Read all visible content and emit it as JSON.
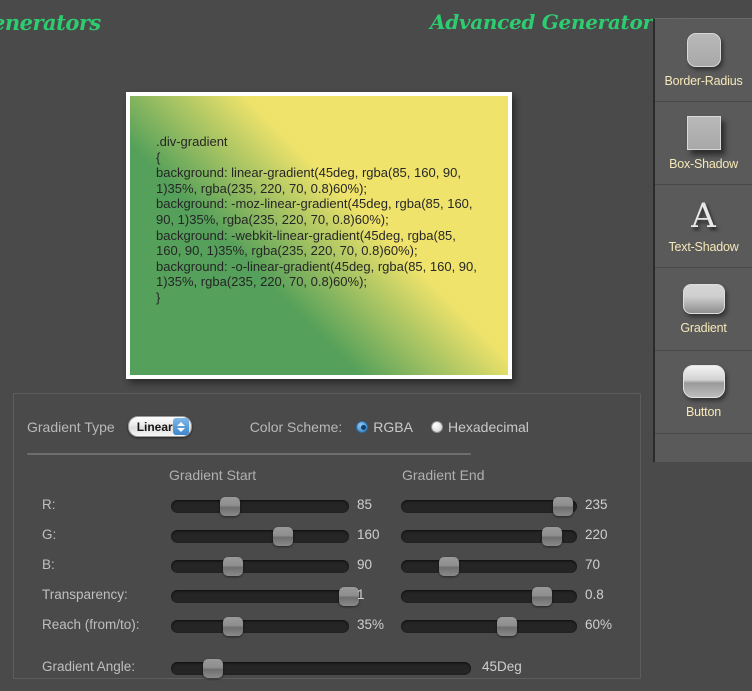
{
  "header": {
    "brand_left": "enerators",
    "brand_right": "Advanced Generators",
    "arrow": "→"
  },
  "sidebar": {
    "items": [
      {
        "label": "Border-Radius",
        "icon": "rounded-square-icon"
      },
      {
        "label": "Box-Shadow",
        "icon": "shadowed-square-icon"
      },
      {
        "label": "Text-Shadow",
        "icon": "letter-a-icon"
      },
      {
        "label": "Gradient",
        "icon": "gradient-swatch-icon"
      },
      {
        "label": "Button",
        "icon": "glossy-button-icon"
      }
    ]
  },
  "preview": {
    "css_code": ".div-gradient\n{\nbackground: linear-gradient(45deg, rgba(85, 160, 90, 1)35%, rgba(235, 220, 70, 0.8)60%);\nbackground: -moz-linear-gradient(45deg, rgba(85, 160, 90, 1)35%, rgba(235, 220, 70, 0.8)60%);\nbackground: -webkit-linear-gradient(45deg, rgba(85, 160, 90, 1)35%, rgba(235, 220, 70, 0.8)60%);\nbackground: -o-linear-gradient(45deg, rgba(85, 160, 90, 1)35%, rgba(235, 220, 70, 0.8)60%);\n}",
    "start_color": "#55a05a",
    "end_color": "#ebdc46"
  },
  "controls": {
    "gradient_type_label": "Gradient Type",
    "gradient_type_value": "Linear",
    "color_scheme_label": "Color Scheme:",
    "scheme_options": [
      {
        "label": "RGBA",
        "selected": true
      },
      {
        "label": "Hexadecimal",
        "selected": false
      }
    ],
    "column_start": "Gradient Start",
    "column_end": "Gradient End",
    "rows": [
      {
        "name": "R:",
        "start_value": "85",
        "start_pct": 33,
        "end_value": "235",
        "end_pct": 92
      },
      {
        "name": "G:",
        "start_value": "160",
        "start_pct": 63,
        "end_value": "220",
        "end_pct": 86
      },
      {
        "name": "B:",
        "start_value": "90",
        "start_pct": 35,
        "end_value": "70",
        "end_pct": 27
      },
      {
        "name": "Transparency:",
        "start_value": "1",
        "start_pct": 100,
        "end_value": "0.8",
        "end_pct": 80
      },
      {
        "name": "Reach (from/to):",
        "start_value": "35%",
        "start_pct": 35,
        "end_value": "60%",
        "end_pct": 60
      }
    ],
    "angle": {
      "name": "Gradient Angle:",
      "value": "45Deg",
      "pct": 14
    }
  }
}
